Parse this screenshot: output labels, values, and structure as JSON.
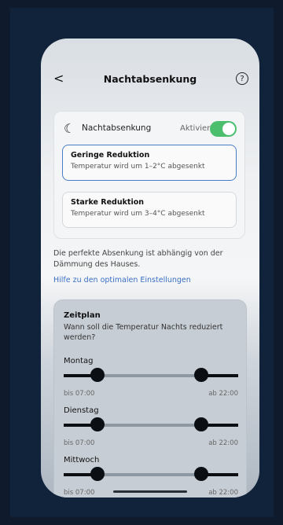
{
  "header": {
    "back_icon": "chevron-left-icon",
    "back_glyph": "<",
    "title": "Nachtabsenkung",
    "help_glyph": "?"
  },
  "toggle": {
    "icon": "moon-icon",
    "label": "Nachtabsenkung",
    "status": "Aktiviert",
    "on": true,
    "accent_color": "#4cbf6f"
  },
  "options": [
    {
      "title": "Geringe Reduktion",
      "subtitle": "Temperatur wird um 1–2°C abgesenkt",
      "selected": true
    },
    {
      "title": "Starke Reduktion",
      "subtitle": "Temperatur wird um 3–4°C abgesenkt",
      "selected": false
    }
  ],
  "note": "Die perfekte Absenkung ist abhängig von der Dämmung des Hauses.",
  "link": "Hilfe zu den optimalen Einstellungen",
  "schedule": {
    "title": "Zeitplan",
    "description": "Wann soll die Temperatur Nachts reduziert werden?",
    "days": [
      {
        "name": "Montag",
        "start": "bis 07:00",
        "end": "ab 22:00"
      },
      {
        "name": "Dienstag",
        "start": "bis 07:00",
        "end": "ab 22:00"
      },
      {
        "name": "Mittwoch",
        "start": "bis 07:00",
        "end": "ab 22:00"
      }
    ]
  },
  "colors": {
    "link": "#3b6fc4",
    "selected_border": "#4a7cc7",
    "background": "#11233b"
  }
}
